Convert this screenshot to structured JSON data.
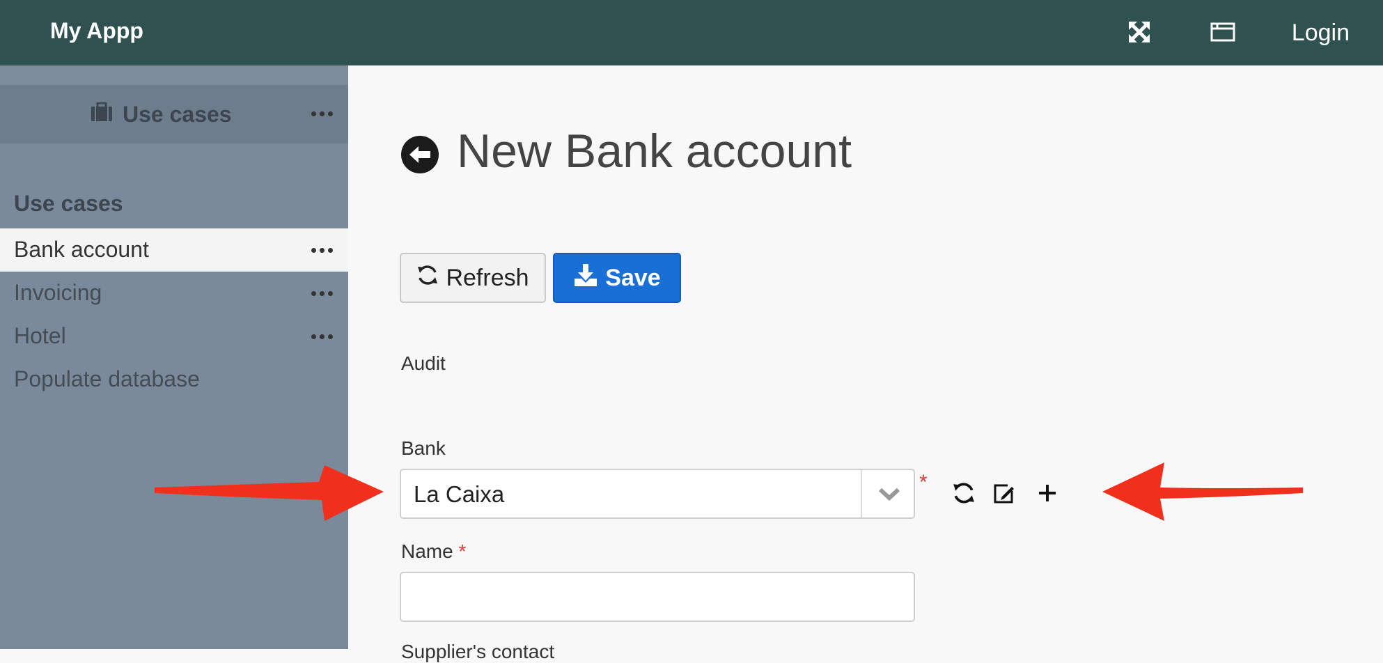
{
  "app": {
    "title": "My Appp",
    "login_label": "Login"
  },
  "topbar_icons": [
    "fullscreen-icon",
    "window-icon"
  ],
  "sidebar": {
    "header": {
      "icon": "briefcase-icon",
      "title": "Use cases"
    },
    "section_title": "Use cases",
    "items": [
      {
        "label": "Bank account",
        "active": true,
        "has_menu": true
      },
      {
        "label": "Invoicing",
        "active": false,
        "has_menu": true
      },
      {
        "label": "Hotel",
        "active": false,
        "has_menu": true
      },
      {
        "label": "Populate database",
        "active": false,
        "has_menu": false
      }
    ]
  },
  "page": {
    "title": "New Bank account",
    "back_icon": "arrow-left-circle-icon"
  },
  "toolbar": {
    "refresh_label": "Refresh",
    "save_label": "Save"
  },
  "form": {
    "audit_label": "Audit",
    "bank": {
      "label": "Bank",
      "value": "La Caixa",
      "required_mark": "*",
      "actions": [
        "refresh-icon",
        "edit-icon",
        "plus-icon"
      ]
    },
    "name": {
      "label": "Name",
      "required_mark": "*",
      "value": "",
      "placeholder": ""
    },
    "next_label": "Supplier's contact"
  },
  "colors": {
    "topbar": "#2f5150",
    "sidebar": "#7a8a9a",
    "save_button": "#1a6fd6",
    "required": "#e03a3a",
    "annotation_arrow": "#f0301c"
  }
}
